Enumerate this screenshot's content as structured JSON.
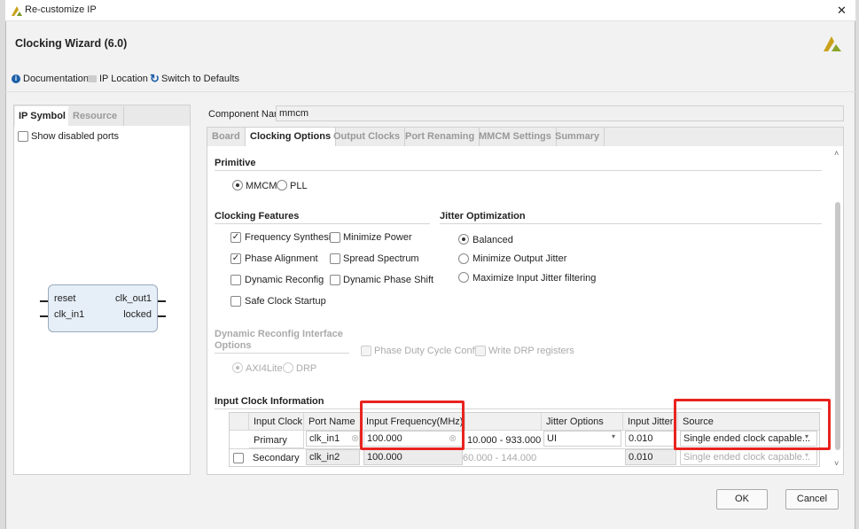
{
  "window": {
    "title": "Re-customize IP",
    "close": "✕"
  },
  "header": {
    "title": "Clocking Wizard (6.0)"
  },
  "toolbar": {
    "documentation": "Documentation",
    "ip_location": "IP Location",
    "switch_defaults": "Switch to Defaults"
  },
  "left_panel": {
    "tabs": [
      "IP Symbol",
      "Resource"
    ],
    "show_disabled_ports": "Show disabled ports",
    "symbol": {
      "inputs": [
        "reset",
        "clk_in1"
      ],
      "outputs": [
        "clk_out1",
        "locked"
      ]
    }
  },
  "component_name": {
    "label": "Component Name",
    "value": "mmcm"
  },
  "tabs": [
    "Board",
    "Clocking Options",
    "Output Clocks",
    "Port Renaming",
    "MMCM Settings",
    "Summary"
  ],
  "primitive": {
    "heading": "Primitive",
    "options": [
      "MMCM",
      "PLL"
    ],
    "selected": "MMCM"
  },
  "clocking_features": {
    "heading": "Clocking Features",
    "items": [
      {
        "label": "Frequency Synthesis",
        "checked": true
      },
      {
        "label": "Minimize Power",
        "checked": false
      },
      {
        "label": "Phase Alignment",
        "checked": true
      },
      {
        "label": "Spread Spectrum",
        "checked": false
      },
      {
        "label": "Dynamic Reconfig",
        "checked": false
      },
      {
        "label": "Dynamic Phase Shift",
        "checked": false
      },
      {
        "label": "Safe Clock Startup",
        "checked": false
      }
    ]
  },
  "jitter_optimization": {
    "heading": "Jitter Optimization",
    "options": [
      "Balanced",
      "Minimize Output Jitter",
      "Maximize Input Jitter filtering"
    ],
    "selected": "Balanced"
  },
  "dynamic_reconfig": {
    "heading_line1": "Dynamic Reconfig Interface",
    "heading_line2": "Options",
    "phase_duty": "Phase Duty Cycle Config",
    "write_drp": "Write DRP registers",
    "options": [
      "AXI4Lite",
      "DRP"
    ],
    "selected": "AXI4Lite"
  },
  "input_clock": {
    "heading": "Input Clock Information",
    "columns": [
      "Input Clock",
      "Port Name",
      "Input Frequency(MHz)",
      "",
      "Jitter Options",
      "Input Jitter",
      "Source"
    ],
    "rows": [
      {
        "clock": "Primary",
        "port": "clk_in1",
        "freq": "100.000",
        "range": "10.000 - 933.000",
        "jitter_opt": "UI",
        "jitter": "0.010",
        "source": "Single ended clock capable..."
      },
      {
        "clock": "Secondary",
        "port": "clk_in2",
        "freq": "100.000",
        "range": "60.000 - 144.000",
        "jitter_opt": "",
        "jitter": "0.010",
        "source": "Single ended clock capable..."
      }
    ]
  },
  "buttons": {
    "ok": "OK",
    "cancel": "Cancel"
  },
  "colors": {
    "highlight": "#e8231f",
    "info": "#1d5fa8"
  }
}
